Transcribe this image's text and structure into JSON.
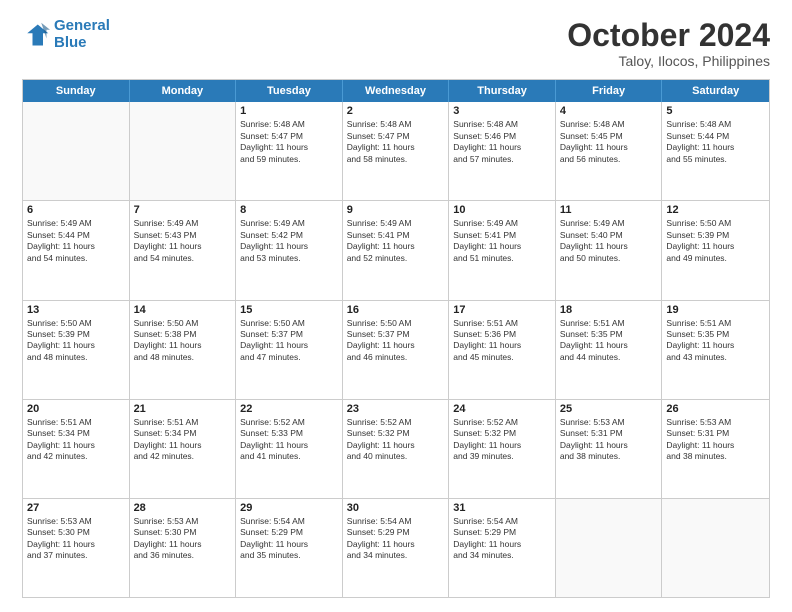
{
  "logo": {
    "line1": "General",
    "line2": "Blue"
  },
  "title": "October 2024",
  "location": "Taloy, Ilocos, Philippines",
  "header": {
    "days": [
      "Sunday",
      "Monday",
      "Tuesday",
      "Wednesday",
      "Thursday",
      "Friday",
      "Saturday"
    ]
  },
  "weeks": [
    [
      {
        "day": "",
        "info": ""
      },
      {
        "day": "",
        "info": ""
      },
      {
        "day": "1",
        "info": "Sunrise: 5:48 AM\nSunset: 5:47 PM\nDaylight: 11 hours\nand 59 minutes."
      },
      {
        "day": "2",
        "info": "Sunrise: 5:48 AM\nSunset: 5:47 PM\nDaylight: 11 hours\nand 58 minutes."
      },
      {
        "day": "3",
        "info": "Sunrise: 5:48 AM\nSunset: 5:46 PM\nDaylight: 11 hours\nand 57 minutes."
      },
      {
        "day": "4",
        "info": "Sunrise: 5:48 AM\nSunset: 5:45 PM\nDaylight: 11 hours\nand 56 minutes."
      },
      {
        "day": "5",
        "info": "Sunrise: 5:48 AM\nSunset: 5:44 PM\nDaylight: 11 hours\nand 55 minutes."
      }
    ],
    [
      {
        "day": "6",
        "info": "Sunrise: 5:49 AM\nSunset: 5:44 PM\nDaylight: 11 hours\nand 54 minutes."
      },
      {
        "day": "7",
        "info": "Sunrise: 5:49 AM\nSunset: 5:43 PM\nDaylight: 11 hours\nand 54 minutes."
      },
      {
        "day": "8",
        "info": "Sunrise: 5:49 AM\nSunset: 5:42 PM\nDaylight: 11 hours\nand 53 minutes."
      },
      {
        "day": "9",
        "info": "Sunrise: 5:49 AM\nSunset: 5:41 PM\nDaylight: 11 hours\nand 52 minutes."
      },
      {
        "day": "10",
        "info": "Sunrise: 5:49 AM\nSunset: 5:41 PM\nDaylight: 11 hours\nand 51 minutes."
      },
      {
        "day": "11",
        "info": "Sunrise: 5:49 AM\nSunset: 5:40 PM\nDaylight: 11 hours\nand 50 minutes."
      },
      {
        "day": "12",
        "info": "Sunrise: 5:50 AM\nSunset: 5:39 PM\nDaylight: 11 hours\nand 49 minutes."
      }
    ],
    [
      {
        "day": "13",
        "info": "Sunrise: 5:50 AM\nSunset: 5:39 PM\nDaylight: 11 hours\nand 48 minutes."
      },
      {
        "day": "14",
        "info": "Sunrise: 5:50 AM\nSunset: 5:38 PM\nDaylight: 11 hours\nand 48 minutes."
      },
      {
        "day": "15",
        "info": "Sunrise: 5:50 AM\nSunset: 5:37 PM\nDaylight: 11 hours\nand 47 minutes."
      },
      {
        "day": "16",
        "info": "Sunrise: 5:50 AM\nSunset: 5:37 PM\nDaylight: 11 hours\nand 46 minutes."
      },
      {
        "day": "17",
        "info": "Sunrise: 5:51 AM\nSunset: 5:36 PM\nDaylight: 11 hours\nand 45 minutes."
      },
      {
        "day": "18",
        "info": "Sunrise: 5:51 AM\nSunset: 5:35 PM\nDaylight: 11 hours\nand 44 minutes."
      },
      {
        "day": "19",
        "info": "Sunrise: 5:51 AM\nSunset: 5:35 PM\nDaylight: 11 hours\nand 43 minutes."
      }
    ],
    [
      {
        "day": "20",
        "info": "Sunrise: 5:51 AM\nSunset: 5:34 PM\nDaylight: 11 hours\nand 42 minutes."
      },
      {
        "day": "21",
        "info": "Sunrise: 5:51 AM\nSunset: 5:34 PM\nDaylight: 11 hours\nand 42 minutes."
      },
      {
        "day": "22",
        "info": "Sunrise: 5:52 AM\nSunset: 5:33 PM\nDaylight: 11 hours\nand 41 minutes."
      },
      {
        "day": "23",
        "info": "Sunrise: 5:52 AM\nSunset: 5:32 PM\nDaylight: 11 hours\nand 40 minutes."
      },
      {
        "day": "24",
        "info": "Sunrise: 5:52 AM\nSunset: 5:32 PM\nDaylight: 11 hours\nand 39 minutes."
      },
      {
        "day": "25",
        "info": "Sunrise: 5:53 AM\nSunset: 5:31 PM\nDaylight: 11 hours\nand 38 minutes."
      },
      {
        "day": "26",
        "info": "Sunrise: 5:53 AM\nSunset: 5:31 PM\nDaylight: 11 hours\nand 38 minutes."
      }
    ],
    [
      {
        "day": "27",
        "info": "Sunrise: 5:53 AM\nSunset: 5:30 PM\nDaylight: 11 hours\nand 37 minutes."
      },
      {
        "day": "28",
        "info": "Sunrise: 5:53 AM\nSunset: 5:30 PM\nDaylight: 11 hours\nand 36 minutes."
      },
      {
        "day": "29",
        "info": "Sunrise: 5:54 AM\nSunset: 5:29 PM\nDaylight: 11 hours\nand 35 minutes."
      },
      {
        "day": "30",
        "info": "Sunrise: 5:54 AM\nSunset: 5:29 PM\nDaylight: 11 hours\nand 34 minutes."
      },
      {
        "day": "31",
        "info": "Sunrise: 5:54 AM\nSunset: 5:29 PM\nDaylight: 11 hours\nand 34 minutes."
      },
      {
        "day": "",
        "info": ""
      },
      {
        "day": "",
        "info": ""
      }
    ]
  ]
}
